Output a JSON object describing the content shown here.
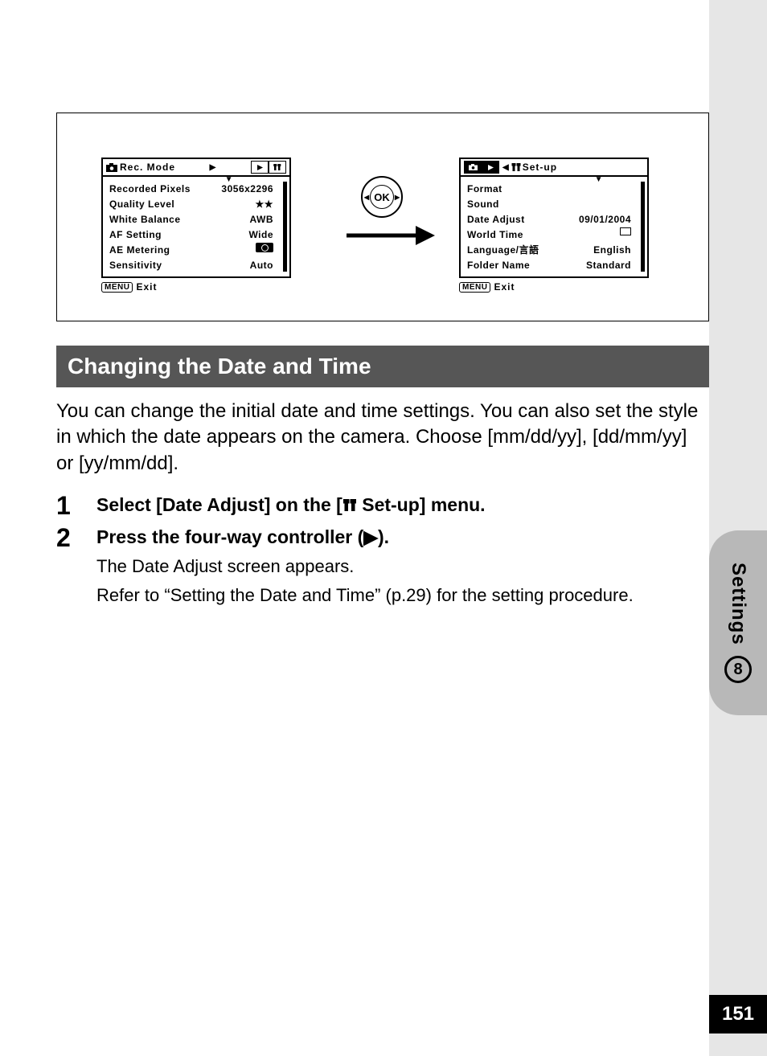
{
  "sidebar": {
    "section_label": "Settings",
    "section_number": "8"
  },
  "page_number": "151",
  "rec_mode_screen": {
    "title": "Rec. Mode",
    "rows": [
      {
        "label": "Recorded Pixels",
        "value": "3056x2296"
      },
      {
        "label": "Quality Level",
        "value": "★★"
      },
      {
        "label": "White Balance",
        "value": "AWB"
      },
      {
        "label": "AF Setting",
        "value": "Wide"
      },
      {
        "label": "AE Metering",
        "value": ""
      },
      {
        "label": "Sensitivity",
        "value": "Auto"
      }
    ],
    "footer_prefix": "MENU",
    "footer_label": "Exit"
  },
  "ok_button_label": "OK",
  "setup_screen": {
    "title": "Set-up",
    "rows": [
      {
        "label": "Format",
        "value": ""
      },
      {
        "label": "Sound",
        "value": ""
      },
      {
        "label": "Date Adjust",
        "value": "09/01/2004"
      },
      {
        "label": "World Time",
        "value": ""
      },
      {
        "label": "Language/言語",
        "value": "English"
      },
      {
        "label": "Folder Name",
        "value": "Standard"
      }
    ],
    "footer_prefix": "MENU",
    "footer_label": "Exit"
  },
  "heading": "Changing the Date and Time",
  "intro": "You can change the initial date and time settings. You can also set the style in which the date appears on the camera. Choose [mm/dd/yy], [dd/mm/yy] or [yy/mm/dd].",
  "steps": [
    {
      "n": "1",
      "title_pre": "Select [Date Adjust] on the [",
      "title_post": " Set-up] menu."
    },
    {
      "n": "2",
      "title": "Press the four-way controller (▶).",
      "sub1": "The Date Adjust screen appears.",
      "sub2": "Refer to “Setting the Date and Time” (p.29) for the setting procedure."
    }
  ]
}
